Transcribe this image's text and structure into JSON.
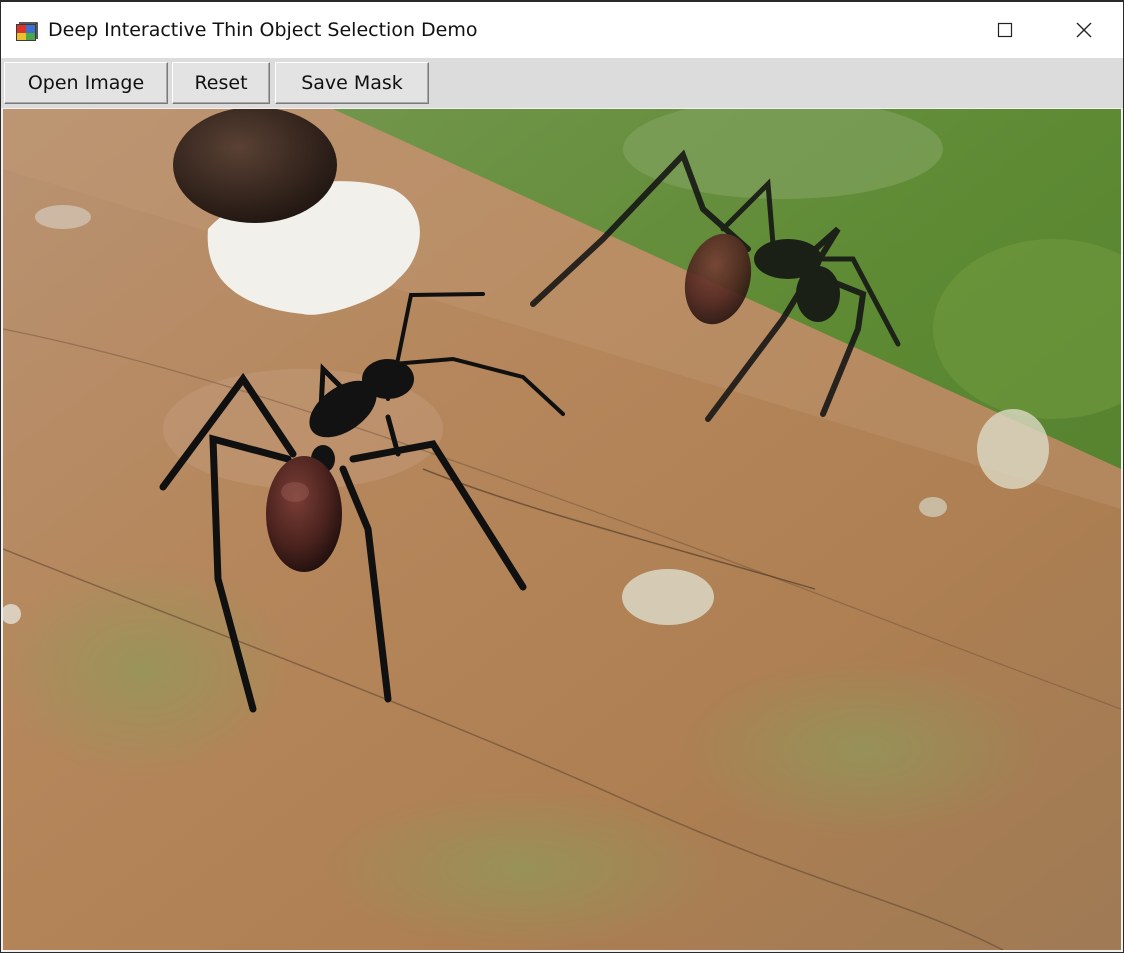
{
  "window": {
    "title": "Deep Interactive Thin Object Selection Demo",
    "controls": {
      "minimize_icon": "minimize-icon",
      "maximize_icon": "maximize-icon",
      "close_icon": "close-icon"
    }
  },
  "toolbar": {
    "open_label": "Open Image",
    "reset_label": "Reset",
    "save_label": "Save Mask"
  },
  "canvas": {
    "content": "photo of two black ants on a wooden surface"
  },
  "colors": {
    "titlebar_bg": "#ffffff",
    "toolbar_bg": "#dcdcdc",
    "button_bg": "#e3e3e3",
    "wood": "#b88c5e",
    "foliage": "#5e8a34",
    "ant_body": "#151515",
    "ant_abdomen": "#5a2a24"
  }
}
